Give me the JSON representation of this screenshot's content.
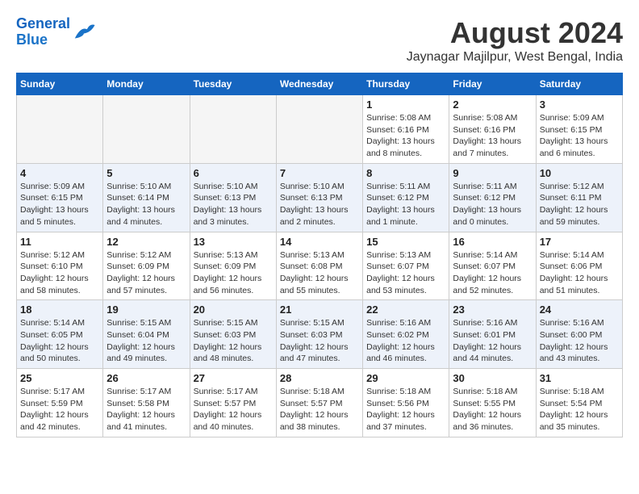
{
  "header": {
    "logo_line1": "General",
    "logo_line2": "Blue",
    "month_title": "August 2024",
    "location": "Jaynagar Majilpur, West Bengal, India"
  },
  "weekdays": [
    "Sunday",
    "Monday",
    "Tuesday",
    "Wednesday",
    "Thursday",
    "Friday",
    "Saturday"
  ],
  "weeks": [
    [
      {
        "day": "",
        "info": ""
      },
      {
        "day": "",
        "info": ""
      },
      {
        "day": "",
        "info": ""
      },
      {
        "day": "",
        "info": ""
      },
      {
        "day": "1",
        "info": "Sunrise: 5:08 AM\nSunset: 6:16 PM\nDaylight: 13 hours\nand 8 minutes."
      },
      {
        "day": "2",
        "info": "Sunrise: 5:08 AM\nSunset: 6:16 PM\nDaylight: 13 hours\nand 7 minutes."
      },
      {
        "day": "3",
        "info": "Sunrise: 5:09 AM\nSunset: 6:15 PM\nDaylight: 13 hours\nand 6 minutes."
      }
    ],
    [
      {
        "day": "4",
        "info": "Sunrise: 5:09 AM\nSunset: 6:15 PM\nDaylight: 13 hours\nand 5 minutes."
      },
      {
        "day": "5",
        "info": "Sunrise: 5:10 AM\nSunset: 6:14 PM\nDaylight: 13 hours\nand 4 minutes."
      },
      {
        "day": "6",
        "info": "Sunrise: 5:10 AM\nSunset: 6:13 PM\nDaylight: 13 hours\nand 3 minutes."
      },
      {
        "day": "7",
        "info": "Sunrise: 5:10 AM\nSunset: 6:13 PM\nDaylight: 13 hours\nand 2 minutes."
      },
      {
        "day": "8",
        "info": "Sunrise: 5:11 AM\nSunset: 6:12 PM\nDaylight: 13 hours\nand 1 minute."
      },
      {
        "day": "9",
        "info": "Sunrise: 5:11 AM\nSunset: 6:12 PM\nDaylight: 13 hours\nand 0 minutes."
      },
      {
        "day": "10",
        "info": "Sunrise: 5:12 AM\nSunset: 6:11 PM\nDaylight: 12 hours\nand 59 minutes."
      }
    ],
    [
      {
        "day": "11",
        "info": "Sunrise: 5:12 AM\nSunset: 6:10 PM\nDaylight: 12 hours\nand 58 minutes."
      },
      {
        "day": "12",
        "info": "Sunrise: 5:12 AM\nSunset: 6:09 PM\nDaylight: 12 hours\nand 57 minutes."
      },
      {
        "day": "13",
        "info": "Sunrise: 5:13 AM\nSunset: 6:09 PM\nDaylight: 12 hours\nand 56 minutes."
      },
      {
        "day": "14",
        "info": "Sunrise: 5:13 AM\nSunset: 6:08 PM\nDaylight: 12 hours\nand 55 minutes."
      },
      {
        "day": "15",
        "info": "Sunrise: 5:13 AM\nSunset: 6:07 PM\nDaylight: 12 hours\nand 53 minutes."
      },
      {
        "day": "16",
        "info": "Sunrise: 5:14 AM\nSunset: 6:07 PM\nDaylight: 12 hours\nand 52 minutes."
      },
      {
        "day": "17",
        "info": "Sunrise: 5:14 AM\nSunset: 6:06 PM\nDaylight: 12 hours\nand 51 minutes."
      }
    ],
    [
      {
        "day": "18",
        "info": "Sunrise: 5:14 AM\nSunset: 6:05 PM\nDaylight: 12 hours\nand 50 minutes."
      },
      {
        "day": "19",
        "info": "Sunrise: 5:15 AM\nSunset: 6:04 PM\nDaylight: 12 hours\nand 49 minutes."
      },
      {
        "day": "20",
        "info": "Sunrise: 5:15 AM\nSunset: 6:03 PM\nDaylight: 12 hours\nand 48 minutes."
      },
      {
        "day": "21",
        "info": "Sunrise: 5:15 AM\nSunset: 6:03 PM\nDaylight: 12 hours\nand 47 minutes."
      },
      {
        "day": "22",
        "info": "Sunrise: 5:16 AM\nSunset: 6:02 PM\nDaylight: 12 hours\nand 46 minutes."
      },
      {
        "day": "23",
        "info": "Sunrise: 5:16 AM\nSunset: 6:01 PM\nDaylight: 12 hours\nand 44 minutes."
      },
      {
        "day": "24",
        "info": "Sunrise: 5:16 AM\nSunset: 6:00 PM\nDaylight: 12 hours\nand 43 minutes."
      }
    ],
    [
      {
        "day": "25",
        "info": "Sunrise: 5:17 AM\nSunset: 5:59 PM\nDaylight: 12 hours\nand 42 minutes."
      },
      {
        "day": "26",
        "info": "Sunrise: 5:17 AM\nSunset: 5:58 PM\nDaylight: 12 hours\nand 41 minutes."
      },
      {
        "day": "27",
        "info": "Sunrise: 5:17 AM\nSunset: 5:57 PM\nDaylight: 12 hours\nand 40 minutes."
      },
      {
        "day": "28",
        "info": "Sunrise: 5:18 AM\nSunset: 5:57 PM\nDaylight: 12 hours\nand 38 minutes."
      },
      {
        "day": "29",
        "info": "Sunrise: 5:18 AM\nSunset: 5:56 PM\nDaylight: 12 hours\nand 37 minutes."
      },
      {
        "day": "30",
        "info": "Sunrise: 5:18 AM\nSunset: 5:55 PM\nDaylight: 12 hours\nand 36 minutes."
      },
      {
        "day": "31",
        "info": "Sunrise: 5:18 AM\nSunset: 5:54 PM\nDaylight: 12 hours\nand 35 minutes."
      }
    ]
  ]
}
